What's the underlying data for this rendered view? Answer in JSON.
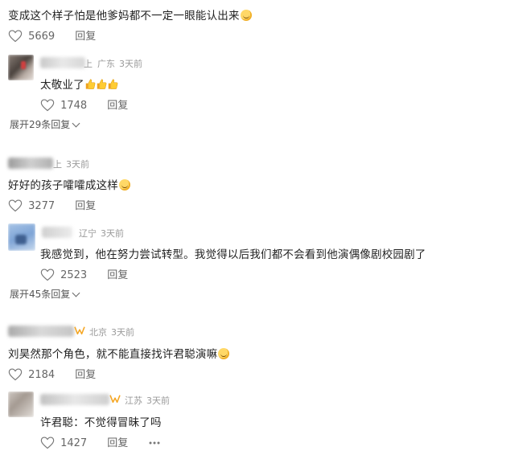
{
  "comments": [
    {
      "text": "变成这个样子怕是他爹妈都不一定一眼能认出来",
      "likes": "5669",
      "reply": "回复"
    },
    {
      "username_tail": "上",
      "location": "广东",
      "time": "3天前",
      "text": "太敬业了",
      "likes": "1748",
      "reply": "回复",
      "expand": "展开29条回复"
    },
    {
      "username_tail": "上",
      "time": "3天前",
      "text": "好好的孩子嚯嚯成这样",
      "likes": "3277",
      "reply": "回复"
    },
    {
      "location": "辽宁",
      "time": "3天前",
      "text": "我感觉到，他在努力尝试转型。我觉得以后我们都不会看到他演偶像剧校园剧了",
      "likes": "2523",
      "reply": "回复",
      "expand": "展开45条回复"
    },
    {
      "location": "北京",
      "time": "3天前",
      "text": "刘昊然那个角色，就不能直接找许君聪演嘛",
      "likes": "2184",
      "reply": "回复"
    },
    {
      "location": "江苏",
      "time": "3天前",
      "text": "许君聪：不觉得冒昧了吗",
      "likes": "1427",
      "reply": "回复"
    }
  ],
  "colors": {
    "text": "#222222",
    "meta": "#9a9a9a",
    "action": "#666666",
    "vip": "#f5a623"
  }
}
